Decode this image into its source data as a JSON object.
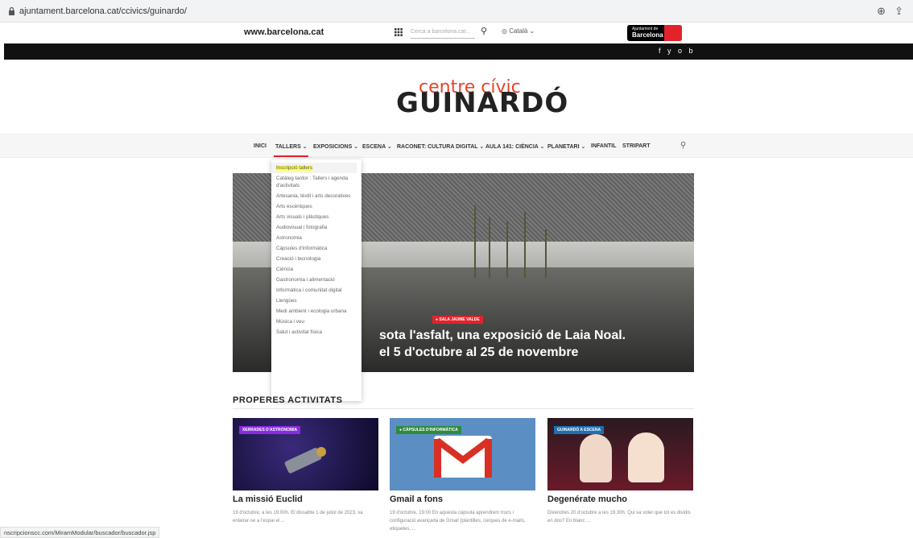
{
  "browser": {
    "url": "ajuntament.barcelona.cat/ccivics/guinardo/"
  },
  "topbar": {
    "site_link": "www.barcelona.cat",
    "search_placeholder": "Cerca a barcelona.cat...",
    "language": "Català",
    "logo_small": "Ajuntament de",
    "logo_big": "Barcelona",
    "social": "f  y  o  b"
  },
  "brand": {
    "line1": "centre cívic",
    "line2": "GUINARDÓ"
  },
  "nav": {
    "items": [
      "INICI",
      "TALLERS",
      "EXPOSICIONS",
      "ESCENA",
      "RACONET: CULTURA DIGITAL",
      "AULA 141: CIÈNCIA",
      "PLANETARI",
      "INFANTIL",
      "STRIPART"
    ]
  },
  "dropdown": {
    "items": [
      "Inscripció tallers",
      "Catàleg tardor : Tallers i agenda d'activitats",
      "Artesania, tèxtil i arts decoratives",
      "Arts escèniques",
      "Arts visuals i plàstiques",
      "Audiovisual i fotografia",
      "Astronomia",
      "Càpsules d'informàtica",
      "Creació i tecnologia",
      "Ciència",
      "Gastronomia i alimentació",
      "Informàtica i comunitat digital",
      "Llengües",
      "Medi ambient i ecologia urbana",
      "Música i veu",
      "Salut i activitat física"
    ]
  },
  "hero": {
    "badge": "● SALA JAUME VALDE",
    "title_line1": "sota l'asfalt, una exposició de Laia Noal.",
    "title_line2": "el 5 d'octubre al 25 de novembre"
  },
  "activities": {
    "heading": "PROPERES ACTIVITATS",
    "cards": [
      {
        "badge": "XERRADES D'ASTRONOMIA",
        "title": "La missió Euclid",
        "desc": "19 d'octubre, a les 19:00h. El dissabte 1 de juliol de 2023, va enlairar-se a l'espai el ...",
        "badge_color": "#8a2be2"
      },
      {
        "badge": "● CÀPSULES D'INFORMÀTICA",
        "title": "Gmail a fons",
        "desc": "19 d'octubre, 19:00 En aquesta càpsula aprendrem trucs i configuració avançada de Gmail (plantilles, cerques de e-mails, etiquetes, ...",
        "badge_color": "#2e8b3e"
      },
      {
        "badge": "GUINARDÓ A ESCENA",
        "title": "Degenérate mucho",
        "desc": "Divendres 20 d'octubre a les 19.30h. Qui va voler que tot es dividís en dos? En blanc ...",
        "badge_color": "#1f6fb2"
      }
    ]
  },
  "status_bar": {
    "text": "nscripcionscc.com/MiramModular/buscador/buscador.jsp"
  }
}
